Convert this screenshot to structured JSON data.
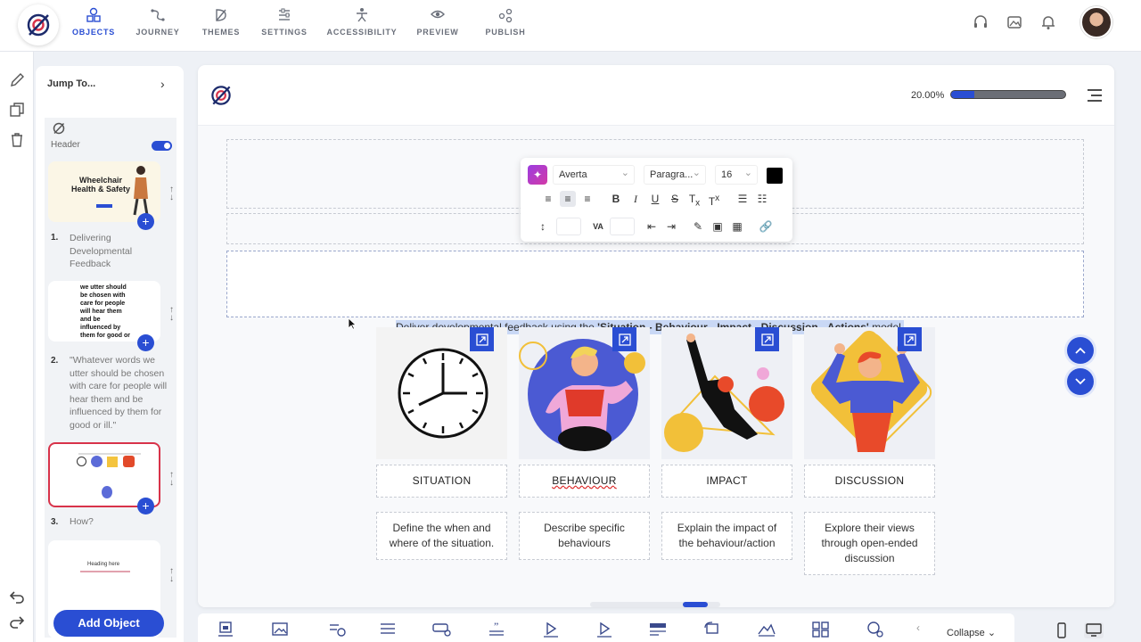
{
  "nav": {
    "items": [
      {
        "label": "OBJECTS",
        "icon": "shapes-icon",
        "active": true
      },
      {
        "label": "JOURNEY",
        "icon": "journey-icon",
        "active": false
      },
      {
        "label": "THEMES",
        "icon": "themes-icon",
        "active": false
      },
      {
        "label": "SETTINGS",
        "icon": "settings-sliders-icon",
        "active": false
      },
      {
        "label": "ACCESSIBILITY",
        "icon": "accessibility-icon",
        "active": false
      },
      {
        "label": "PREVIEW",
        "icon": "eye-icon",
        "active": false
      },
      {
        "label": "PUBLISH",
        "icon": "share-icon",
        "active": false
      }
    ],
    "right_icons": [
      "headset-icon",
      "gallery-icon",
      "bell-icon",
      "avatar"
    ]
  },
  "rail": {
    "icons": [
      "pencil-icon",
      "duplicate-icon",
      "trash-icon",
      "undo-icon",
      "redo-icon"
    ]
  },
  "panel": {
    "jump_to": "Jump To...",
    "header_label": "Header",
    "header_toggle_on": true,
    "slides": [
      {
        "num": "1.",
        "title": "Delivering Developmental Feedback",
        "thumb_heading": "Wheelchair Health & Safety"
      },
      {
        "num": "2.",
        "title": "\"Whatever words we utter should be chosen with care for people will hear them and be influenced by them for good or ill.\"",
        "thumb_heading": "we utter should be chosen with care for people will hear them and be influenced by them for good or"
      },
      {
        "num": "3.",
        "title": "How?",
        "selected": true
      },
      {
        "num": "",
        "title": "",
        "thumb_heading": "Heading here"
      }
    ],
    "add_object": "Add Object"
  },
  "canvas": {
    "progress_text": "20.00%",
    "progress_value": 0.2,
    "toolbar": {
      "font": "Averta",
      "style": "Paragra...",
      "size": "16",
      "color": "#000000"
    },
    "body": {
      "pre": "Deliver developmental feedback using the ",
      "bold": "'Situation - Behaviour - Impact - Discussion - Actions'",
      "post": " model."
    },
    "cards": [
      {
        "title": "SITUATION",
        "desc": "Define the when and where of the situation.",
        "image": "clock-image"
      },
      {
        "title": "BEHAVIOUR",
        "desc": "Describe specific behaviours",
        "image": "person-gesturing-image"
      },
      {
        "title": "IMPACT",
        "desc": "Explain the impact of the behaviour/action",
        "image": "person-pointing-image"
      },
      {
        "title": "DISCUSSION",
        "desc": "Explore their views through open-ended discussion",
        "image": "person-cheering-image"
      }
    ]
  },
  "bottom": {
    "collapse_label": "Collapse",
    "icons": [
      "image-frame-icon",
      "picture-icon",
      "link-objects-icon",
      "text-lines-icon",
      "button-icon",
      "quote-icon",
      "video-play-icon",
      "audio-play-icon",
      "form-icon",
      "rotate-icon",
      "chart-icon",
      "grid-icon",
      "target-icon"
    ],
    "devices": [
      "mobile-icon",
      "desktop-icon"
    ]
  },
  "colors": {
    "accent": "#2a4ed3",
    "selected_border": "#d8334a",
    "highlight": "#c9d8f5"
  }
}
